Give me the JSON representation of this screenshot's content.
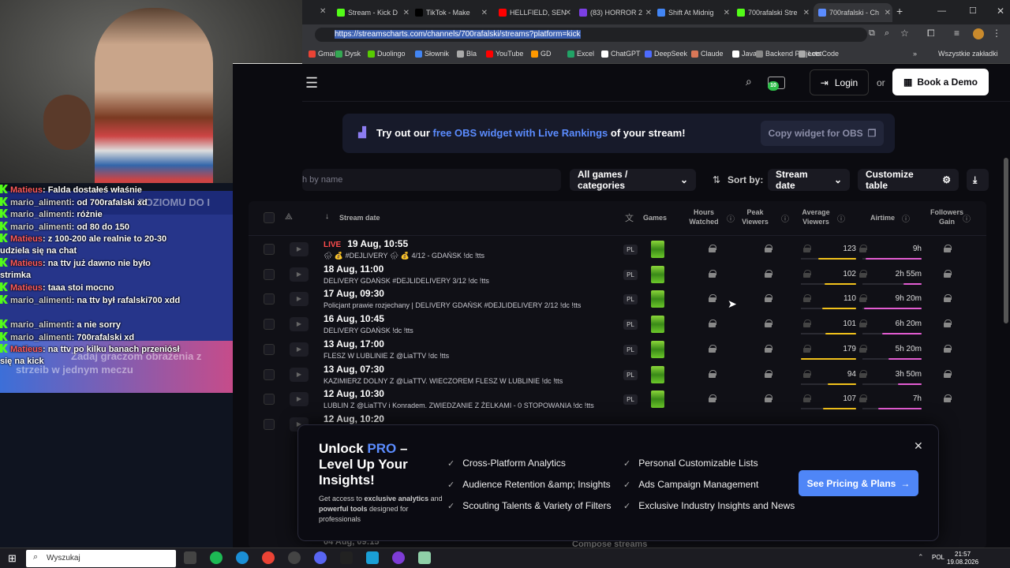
{
  "browser": {
    "tabs": [
      {
        "label": "Stream - Kick D",
        "color": "#53fc18"
      },
      {
        "label": "TikTok - Make",
        "color": "#000000"
      },
      {
        "label": "HELLFIELD, SEN",
        "color": "#ff0000"
      },
      {
        "label": "(83) HORROR 2",
        "color": "#7b3fe4"
      },
      {
        "label": "Shift At Midnig",
        "color": "#4285f4"
      },
      {
        "label": "700rafalski Stre",
        "color": "#53fc18"
      },
      {
        "label": "700rafalski - Ch",
        "color": "#5b8cff"
      }
    ],
    "url": "https://streamscharts.com/channels/700rafalski/streams?platform=kick",
    "bookmarks": [
      "Gmail",
      "Dysk",
      "Duolingo",
      "Słownik",
      "Bla",
      "YouTube",
      "GD",
      "Excel",
      "ChatGPT",
      "DeepSeek",
      "Claude",
      "Java",
      "Backend Projects",
      "LeetCode"
    ],
    "all_bookmarks": "Wszystkie zakładki"
  },
  "chat": {
    "banner_top": "POZIOMU DO I",
    "banner_bottom_1": "Zadaj graczom obrażenia z",
    "banner_bottom_2": "strzeib w jednym meczu",
    "messages": [
      {
        "user": "Matieus",
        "text": "Falda dostałeś właśnie",
        "ucls": "u1"
      },
      {
        "user": "mario_alimenti",
        "text": "od 700rafalski xd",
        "ucls": "u2"
      },
      {
        "user": "mario_alimenti",
        "text": "różnie",
        "ucls": "u2"
      },
      {
        "user": "mario_alimenti",
        "text": "od 80 do 150",
        "ucls": "u2"
      },
      {
        "user": "Matieus",
        "text": "z 100-200 ale realnie to 20-30 udziela się na chat",
        "ucls": "u1"
      },
      {
        "user": "Matieus",
        "text": "na ttv już dawno nie było strimka",
        "ucls": "u1"
      },
      {
        "user": "Matieus",
        "text": "taaa stoi mocno",
        "ucls": "u1"
      },
      {
        "user": "mario_alimenti",
        "text": "na ttv był rafalski700 xdd",
        "ucls": "u2"
      },
      {
        "user": "mario_alimenti",
        "text": "a nie sorry",
        "ucls": "u2"
      },
      {
        "user": "mario_alimenti",
        "text": "700rafalski xd",
        "ucls": "u2"
      },
      {
        "user": "Matieus",
        "text": "na ttv po kilku banach przeniósł się na kick",
        "ucls": "u1"
      }
    ]
  },
  "header": {
    "badge": "10",
    "login": "Login",
    "or": "or",
    "demo": "Book a Demo"
  },
  "obs": {
    "prefix": "Try out our",
    "highlight": "free OBS widget with Live Rankings",
    "suffix": "of your stream!",
    "copy": "Copy widget for OBS"
  },
  "filters": {
    "search_placeholder": "h by name",
    "games": "All games / categories",
    "sort_label": "Sort by:",
    "sort_value": "Stream date",
    "customize": "Customize table"
  },
  "table": {
    "headers": {
      "stream_date": "Stream date",
      "games": "Games",
      "hours_watched": "Hours Watched",
      "peak_viewers": "Peak Viewers",
      "avg_viewers": "Average Viewers",
      "airtime": "Airtime",
      "followers_gain": "Followers Gain"
    },
    "rows": [
      {
        "live": "LIVE",
        "date": "19 Aug, 10:55",
        "title": "🌧 💰 #DEJLIVERY 🌧 💰 4/12 - GDAŃSK !dc !tts",
        "lang": "PL",
        "avg": "123",
        "avg_frac": 0.69,
        "air": "9h",
        "air_frac": 0.95
      },
      {
        "live": "",
        "date": "18 Aug, 11:00",
        "title": "DELIVERY GDAŃSK #DEJLIDELIVERY 3/12 !dc !tts",
        "lang": "PL",
        "avg": "102",
        "avg_frac": 0.57,
        "air": "2h 55m",
        "air_frac": 0.31
      },
      {
        "live": "",
        "date": "17 Aug, 09:30",
        "title": "Policjant prawie rozjechany | DELIVERY GDAŃSK #DEJLIDELIVERY 2/12 !dc !tts",
        "lang": "PL",
        "avg": "110",
        "avg_frac": 0.61,
        "air": "9h 20m",
        "air_frac": 0.98
      },
      {
        "live": "",
        "date": "16 Aug, 10:45",
        "title": "DELIVERY GDAŃSK !dc !tts",
        "lang": "PL",
        "avg": "101",
        "avg_frac": 0.56,
        "air": "6h 20m",
        "air_frac": 0.67
      },
      {
        "live": "",
        "date": "13 Aug, 17:00",
        "title": "FLESZ W LUBLINIE Z @LiaTTV !dc !tts",
        "lang": "PL",
        "avg": "179",
        "avg_frac": 1.0,
        "air": "5h 20m",
        "air_frac": 0.56
      },
      {
        "live": "",
        "date": "13 Aug, 07:30",
        "title": "KAZIMIERZ DOLNY Z @LiaTTV. WIECZOREM FLESZ W LUBLINIE !dc !tts",
        "lang": "PL",
        "avg": "94",
        "avg_frac": 0.52,
        "air": "3h 50m",
        "air_frac": 0.4
      },
      {
        "live": "",
        "date": "12 Aug, 10:30",
        "title": "LUBLIN Z @LiaTTV i Konradem. ZWIEDZANIE Z ŻELKAMI - 0 STOPOWANIA !dc !tts",
        "lang": "PL",
        "avg": "107",
        "avg_frac": 0.6,
        "air": "7h",
        "air_frac": 0.74
      },
      {
        "live": "",
        "date": "12 Aug, 10:20",
        "title": "",
        "lang": "",
        "avg": "",
        "avg_frac": 0,
        "air": "",
        "air_frac": 0
      }
    ],
    "footer_date": "04 Aug, 09:15",
    "footer_title": "Compose streams"
  },
  "pro": {
    "title_1": "Unlock",
    "title_pro": "PRO",
    "title_2": " – Level Up Your Insights!",
    "sub_1": "Get access to ",
    "sub_b1": "exclusive analytics",
    "sub_2": " and ",
    "sub_b2": "powerful tools",
    "sub_3": " designed for professionals",
    "features": [
      "Cross-Platform Analytics",
      "Personal Customizable Lists",
      "Audience Retention &amp; Insights",
      "Ads Campaign Management",
      "Scouting Talents & Variety of Filters",
      "Exclusive Industry Insights and News"
    ],
    "cta": "See Pricing & Plans"
  },
  "taskbar": {
    "search": "Wyszukaj",
    "lang": "POL",
    "time": "21:57",
    "date": "19.08.2026"
  }
}
